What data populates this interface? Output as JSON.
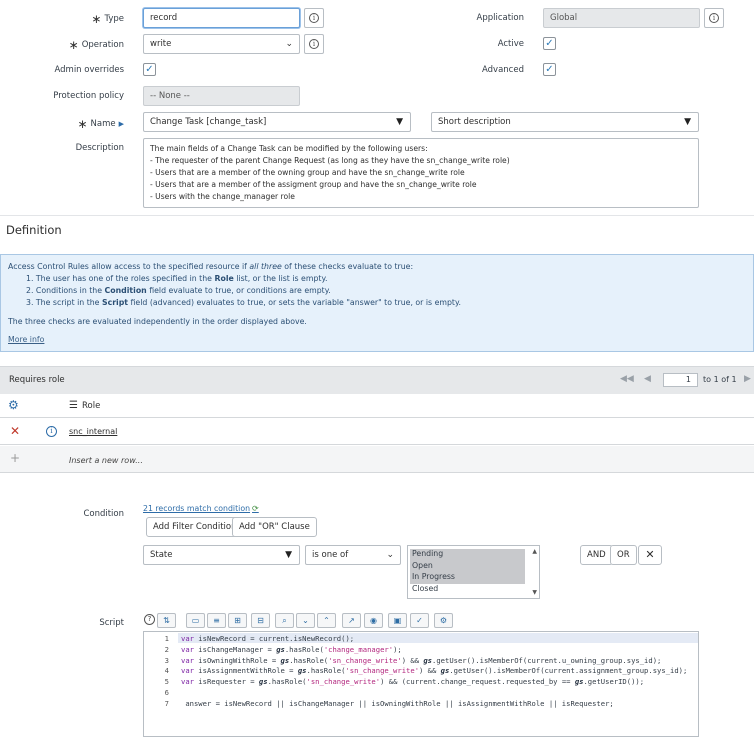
{
  "form": {
    "type_label": "Type",
    "type_value": "record",
    "operation_label": "Operation",
    "operation_value": "write",
    "admin_overrides_label": "Admin overrides",
    "protection_policy_label": "Protection policy",
    "protection_policy_value": "-- None --",
    "name_label": "Name",
    "name_table_value": "Change Task [change_task]",
    "name_field_value": "Short description",
    "description_label": "Description",
    "description_lines": [
      "The main fields of a Change Task can be modified by the following users:",
      "- The requester of the parent Change Request (as long as they have the sn_change_write role)",
      "- Users that are a member of the owning group and have the sn_change_write role",
      "- Users that are a member of the assigment group and have the sn_change_write role",
      "- Users with the change_manager role"
    ],
    "application_label": "Application",
    "application_value": "Global",
    "active_label": "Active",
    "advanced_label": "Advanced"
  },
  "definition": {
    "title": "Definition",
    "intro_pre": "Access Control Rules allow access to the specified resource if ",
    "intro_em": "all three",
    "intro_post": " of these checks evaluate to true:",
    "item1_pre": "1. The user has one of the roles specified in the ",
    "item1_b": "Role",
    "item1_post": " list, or the list is empty.",
    "item2_pre": "2. Conditions in the ",
    "item2_b": "Condition",
    "item2_post": " field evaluate to true, or conditions are empty.",
    "item3_pre": "3. The script in the ",
    "item3_b": "Script",
    "item3_post": " field (advanced) evaluates to true, or sets the variable \"answer\" to true, or is empty.",
    "note": "The three checks are evaluated independently in the order displayed above.",
    "more_info": "More info"
  },
  "requires_role": {
    "title": "Requires role",
    "page_value": "1",
    "page_of": "to 1 of 1",
    "column_role": "Role",
    "rows": [
      {
        "role": "snc_internal"
      }
    ],
    "insert_row": "Insert a new row..."
  },
  "condition": {
    "label": "Condition",
    "match_text": "21 records match condition",
    "add_filter": "Add Filter Condition",
    "add_or": "Add \"OR\" Clause",
    "field": "State",
    "operator": "is one of",
    "options": [
      "Pending",
      "Open",
      "In Progress",
      "Closed"
    ],
    "and_btn": "AND",
    "or_btn": "OR"
  },
  "script": {
    "label": "Script",
    "line_numbers": [
      "1",
      "2",
      "3",
      "4",
      "5",
      "6",
      "7"
    ],
    "lines": [
      {
        "kw": "var",
        "rest": " isNewRecord = current.isNewRecord();"
      },
      {
        "kw": "var",
        "rest1": " isChangeManager = ",
        "gs": "gs",
        "rest2": ".hasRole(",
        "str": "'change_manager'",
        "rest3": ");"
      },
      {
        "kw": "var",
        "rest1": " isOwningWithRole = ",
        "gs": "gs",
        "rest2": ".hasRole(",
        "str": "'sn_change_write'",
        "rest3": ") && ",
        "gs2": "gs",
        "rest4": ".getUser().isMemberOf(current.u_owning_group.sys_id);"
      },
      {
        "kw": "var",
        "rest1": " isAssignmentWithRole = ",
        "gs": "gs",
        "rest2": ".hasRole(",
        "str": "'sn_change_write'",
        "rest3": ") && ",
        "gs2": "gs",
        "rest4": ".getUser().isMemberOf(current.assignment_group.sys_id);"
      },
      {
        "kw": "var",
        "rest1": " isRequester = ",
        "gs": "gs",
        "rest2": ".hasRole(",
        "str": "'sn_change_write'",
        "rest3": ") && (current.change_request.requested_by == ",
        "gs2": "gs",
        "rest4": ".getUserID());"
      },
      {
        "text": ""
      },
      {
        "text": " answer = isNewRecord || isChangeManager || isOwningWithRole || isAssignmentWithRole || isRequester;"
      }
    ]
  },
  "colors": {
    "accent": "#2d6ca8",
    "info_bg": "#e6f1fb",
    "header_bg": "#e6e8ea",
    "remove": "#c0392b"
  }
}
